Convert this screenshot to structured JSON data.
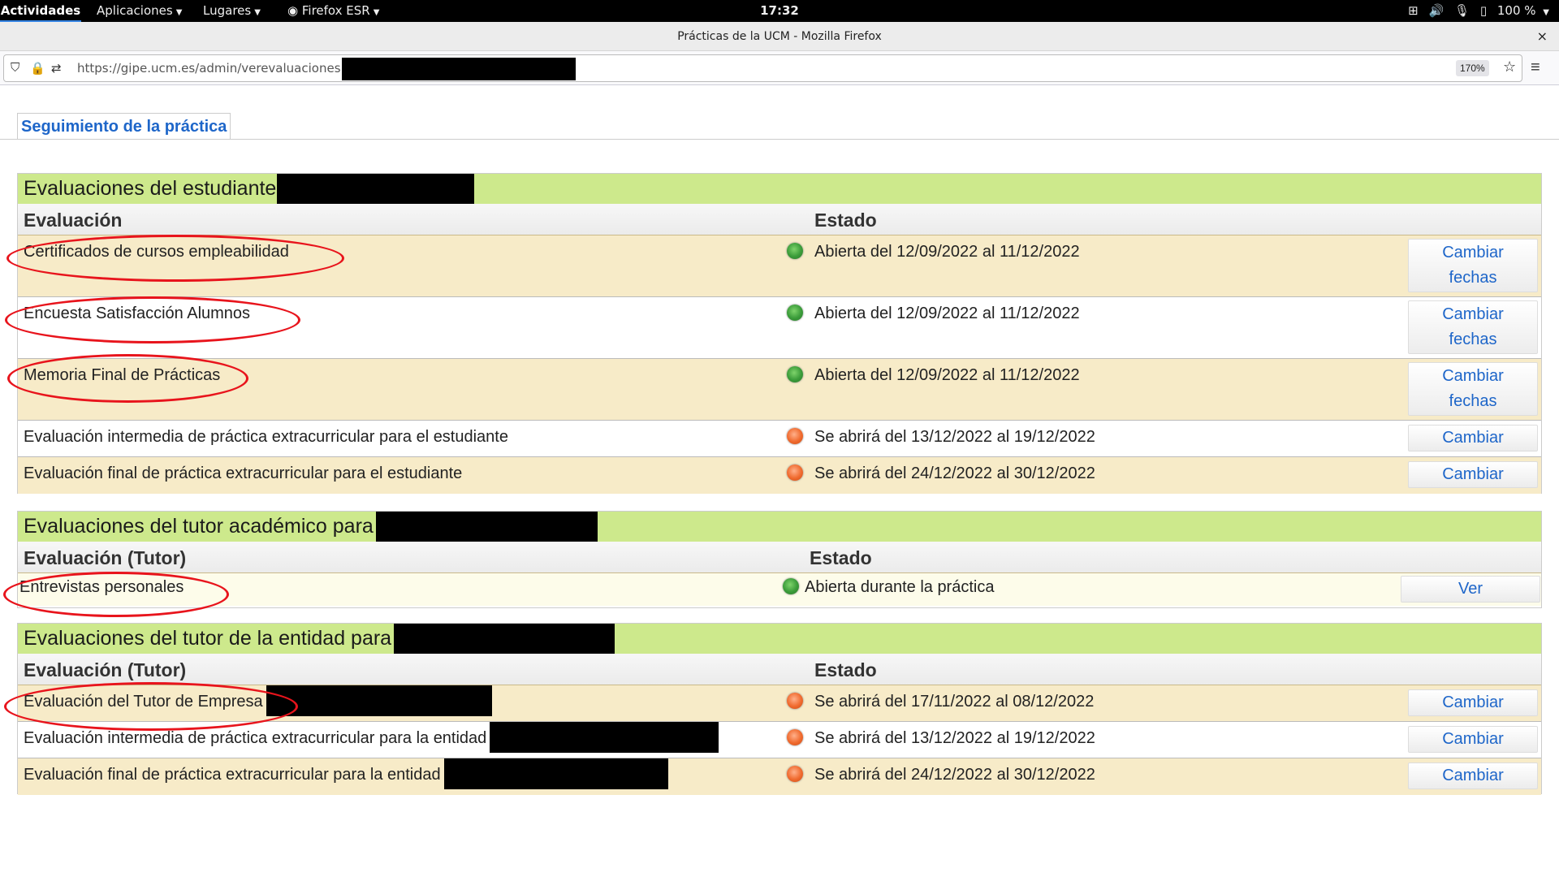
{
  "topbar": {
    "activities": "Actividades",
    "applications": "Aplicaciones",
    "places": "Lugares",
    "firefox": "Firefox ESR",
    "clock": "17:32",
    "battery": "100 %"
  },
  "window": {
    "title": "Prácticas de la UCM - Mozilla Firefox",
    "close": "×"
  },
  "navbar": {
    "url": "https://gipe.ucm.es/admin/verevaluaciones.php",
    "zoom": "170%"
  },
  "page": {
    "tab_label": "Seguimiento de la práctica"
  },
  "sections": {
    "student": {
      "title": "Evaluaciones del estudiante",
      "col_evaluacion": "Evaluación",
      "col_estado": "Estado",
      "rows": [
        {
          "name": "Certificados de cursos empleabilidad",
          "status": "Abierta del 12/09/2022 al 11/12/2022",
          "dot": "green",
          "button": "Cambiar fechas"
        },
        {
          "name": "Encuesta Satisfacción Alumnos",
          "status": "Abierta del 12/09/2022 al 11/12/2022",
          "dot": "green",
          "button": "Cambiar fechas"
        },
        {
          "name": "Memoria Final de Prácticas",
          "status": "Abierta del 12/09/2022 al 11/12/2022",
          "dot": "green",
          "button": "Cambiar fechas"
        },
        {
          "name": "Evaluación intermedia de práctica extracurricular para el estudiante",
          "status": "Se abrirá del 13/12/2022 al 19/12/2022",
          "dot": "orange",
          "button": "Cambiar"
        },
        {
          "name": "Evaluación final de práctica extracurricular para el estudiante",
          "status": "Se abrirá del 24/12/2022 al 30/12/2022",
          "dot": "orange",
          "button": "Cambiar"
        }
      ]
    },
    "academic": {
      "title": "Evaluaciones del tutor académico para",
      "col_evaluacion": "Evaluación (Tutor)",
      "col_estado": "Estado",
      "rows": [
        {
          "name": "Entrevistas personales",
          "status": "Abierta durante la práctica",
          "dot": "green",
          "button": "Ver"
        }
      ]
    },
    "entity": {
      "title": "Evaluaciones del tutor de la entidad para",
      "col_evaluacion": "Evaluación (Tutor)",
      "col_estado": "Estado",
      "rows": [
        {
          "name": "Evaluación del Tutor de Empresa",
          "status": "Se abrirá del 17/11/2022 al 08/12/2022",
          "dot": "orange",
          "button": "Cambiar"
        },
        {
          "name": "Evaluación intermedia de práctica extracurricular para la entidad",
          "status": "Se abrirá del 13/12/2022 al 19/12/2022",
          "dot": "orange",
          "button": "Cambiar"
        },
        {
          "name": "Evaluación final de práctica extracurricular para la entidad",
          "status": "Se abrirá del 24/12/2022 al 30/12/2022",
          "dot": "orange",
          "button": "Cambiar"
        }
      ]
    }
  },
  "colors": {
    "section_header": "#cde98c",
    "row_beige": "#f7ebc8",
    "link_blue": "#1e66c9",
    "annotation_red": "#e8141c"
  }
}
